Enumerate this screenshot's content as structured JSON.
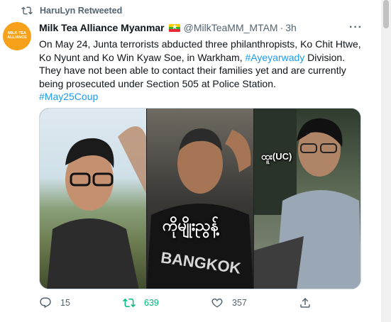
{
  "retweet_header": {
    "text": "HaruLyn Retweeted",
    "icon": "retweet-icon"
  },
  "author": {
    "avatar_text": "MILK TEA ALLIANCE",
    "name": "Milk Tea Alliance Myanmar",
    "flag": "myanmar-flag-icon",
    "handle": "@MilkTeaMM_MTAM",
    "separator": "·",
    "time": "3h"
  },
  "more_label": "···",
  "tweet": {
    "text_before": "On May 24, Junta terrorists abducted three philanthropists, Ko Chit Htwe, Ko Nyunt and Ko Win Kyaw Soe, in Warkham, ",
    "hashtag1": "#Ayeyarwady",
    "text_after": " Division. They have not been able to contact their families yet and are currently being prosecuted under Section 505 at Police Station.",
    "hashtag2": "#May25Coup"
  },
  "media": {
    "caption_burmese": "ကိုမျိုးညွန့်",
    "caption_uc": "ထူး(UC)"
  },
  "actions": {
    "reply_count": "15",
    "retweet_count": "639",
    "like_count": "357"
  },
  "colors": {
    "link": "#1d9bf0",
    "retweeted": "#00ba7c",
    "muted": "#536471",
    "avatar": "#f7a11a"
  }
}
